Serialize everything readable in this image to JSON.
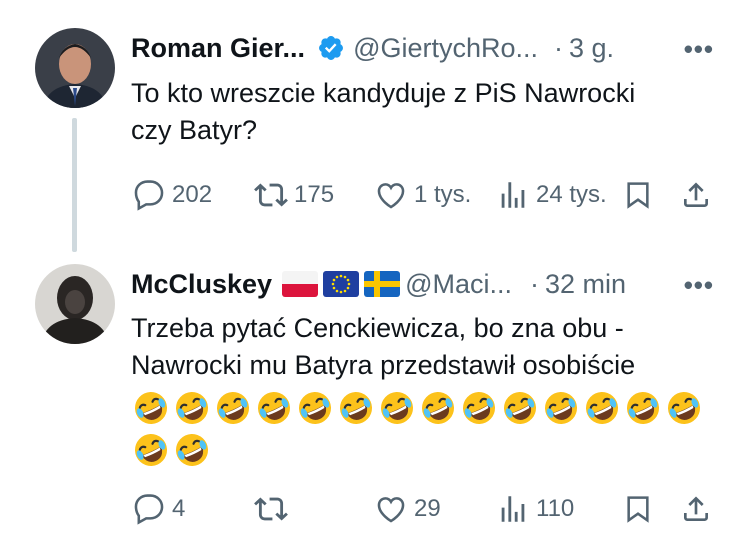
{
  "tweet1": {
    "name": "Roman Gier...",
    "handle": "@GiertychRo...",
    "dot": "·",
    "time": "3 g.",
    "more": "•••",
    "text_line1": "To kto wreszcie kandyduje z PiS Nawrocki",
    "text_line2": "czy Batyr?",
    "replies": "202",
    "retweets": "175",
    "likes": "1 tys.",
    "views": "24 tys."
  },
  "tweet2": {
    "name": "McCluskey",
    "handle": "@Maci...",
    "dot": "·",
    "time": "32 min",
    "more": "•••",
    "text_line1": "Trzeba pytać Cenckiewicza, bo zna obu -",
    "text_line2": "Nawrocki mu Batyra przedstawił osobiście",
    "emoji_name": "rolling-on-the-floor-laughing",
    "emoji_count_row1": 14,
    "emoji_count_row2": 2,
    "replies": "4",
    "retweets": "",
    "likes": "29",
    "views": "110"
  },
  "colors": {
    "text": "#0f1419",
    "muted": "#536471",
    "verified": "#1d9bf0",
    "thread_line": "#cfd9de"
  }
}
